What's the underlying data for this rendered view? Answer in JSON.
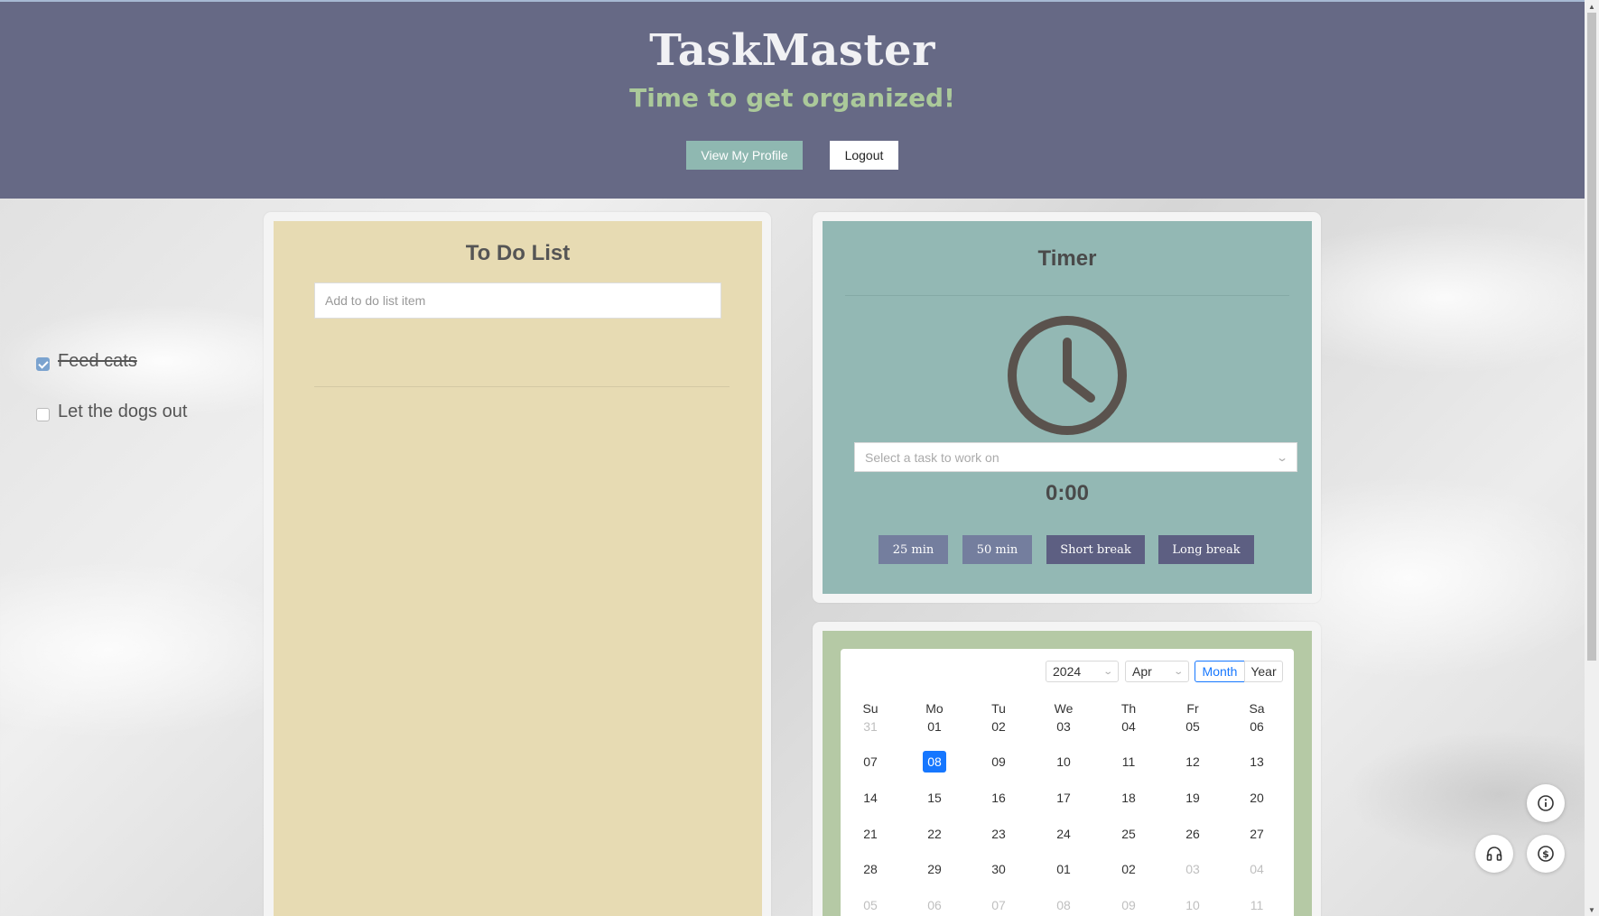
{
  "header": {
    "title": "TaskMaster",
    "tagline": "Time to get organized!",
    "profile_button": "View My Profile",
    "logout_button": "Logout"
  },
  "todo": {
    "title": "To Do List",
    "input_placeholder": "Add to do list item",
    "items": [
      {
        "label": "Feed cats",
        "checked": true
      },
      {
        "label": "Let the dogs out",
        "checked": false
      }
    ]
  },
  "timer": {
    "title": "Timer",
    "task_placeholder": "Select a task to work on",
    "time": "0:00",
    "buttons": [
      "25 min",
      "50 min",
      "Short break",
      "Long break"
    ],
    "icon": "clock-icon"
  },
  "calendar": {
    "year": "2024",
    "month": "Apr",
    "mode_month": "Month",
    "mode_year": "Year",
    "weekdays": [
      "Su",
      "Mo",
      "Tu",
      "We",
      "Th",
      "Fr",
      "Sa"
    ],
    "weeks": [
      [
        "31",
        "01",
        "02",
        "03",
        "04",
        "05",
        "06"
      ],
      [
        "07",
        "08",
        "09",
        "10",
        "11",
        "12",
        "13"
      ],
      [
        "14",
        "15",
        "16",
        "17",
        "18",
        "19",
        "20"
      ],
      [
        "21",
        "22",
        "23",
        "24",
        "25",
        "26",
        "27"
      ],
      [
        "28",
        "29",
        "30",
        "01",
        "02",
        "03",
        "04"
      ],
      [
        "05",
        "06",
        "07",
        "08",
        "09",
        "10",
        "11"
      ]
    ],
    "selected": "08",
    "accent": "#1677ff"
  },
  "colors": {
    "header_bg": "#666985",
    "tagline": "#abc99a",
    "todo_bg": "#e7dbb3",
    "timer_bg": "#93b8b4",
    "calendar_bg": "#b5c9a5"
  },
  "floating_icons": [
    "info-icon",
    "headphones-icon",
    "dollar-icon"
  ]
}
